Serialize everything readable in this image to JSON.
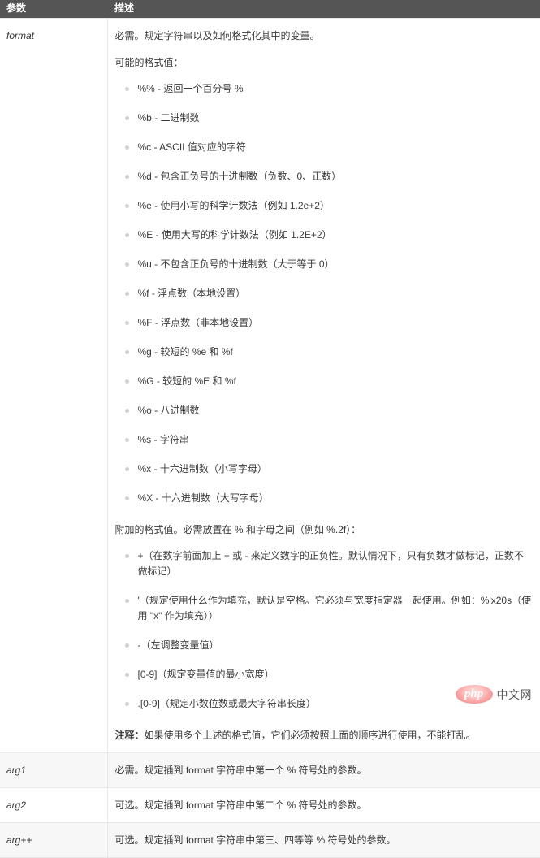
{
  "table": {
    "headers": {
      "param": "参数",
      "desc": "描述"
    },
    "rows": [
      {
        "param": "format",
        "intro1": "必需。规定字符串以及如何格式化其中的变量。",
        "intro2": "可能的格式值：",
        "format_values": [
          "%% - 返回一个百分号 %",
          "%b - 二进制数",
          "%c - ASCII 值对应的字符",
          "%d - 包含正负号的十进制数（负数、0、正数）",
          "%e - 使用小写的科学计数法（例如 1.2e+2）",
          "%E - 使用大写的科学计数法（例如 1.2E+2）",
          "%u - 不包含正负号的十进制数（大于等于 0）",
          "%f - 浮点数（本地设置）",
          "%F - 浮点数（非本地设置）",
          "%g - 较短的 %e 和 %f",
          "%G - 较短的 %E 和 %f",
          "%o - 八进制数",
          "%s - 字符串",
          "%x - 十六进制数（小写字母）",
          "%X - 十六进制数（大写字母）"
        ],
        "extra_intro": "附加的格式值。必需放置在 % 和字母之间（例如 %.2f）：",
        "extra_values": [
          "+（在数字前面加上 + 或 - 来定义数字的正负性。默认情况下，只有负数才做标记，正数不做标记）",
          "'（规定使用什么作为填充，默认是空格。它必须与宽度指定器一起使用。例如：%'x20s（使用 \"x\" 作为填充））",
          "-（左调整变量值）",
          "[0-9]（规定变量值的最小宽度）",
          ".[0-9]（规定小数位数或最大字符串长度）"
        ],
        "note_label": "注释：",
        "note_text": "如果使用多个上述的格式值，它们必须按照上面的顺序进行使用，不能打乱。"
      },
      {
        "param": "arg1",
        "desc": "必需。规定插到 format 字符串中第一个 % 符号处的参数。"
      },
      {
        "param": "arg2",
        "desc": "可选。规定插到 format 字符串中第二个 % 符号处的参数。"
      },
      {
        "param": "arg++",
        "desc": "可选。规定插到 format 字符串中第三、四等等 % 符号处的参数。"
      }
    ]
  },
  "watermark": {
    "badge_text": "php",
    "label": "中文网"
  },
  "colors": {
    "header_bg": "#555555",
    "row_alt_bg": "#f7f7f7",
    "border": "#e8e8e8",
    "text": "#3b3b3b",
    "bullet": "#cfcfcf",
    "watermark_badge": "#f78f8f"
  }
}
